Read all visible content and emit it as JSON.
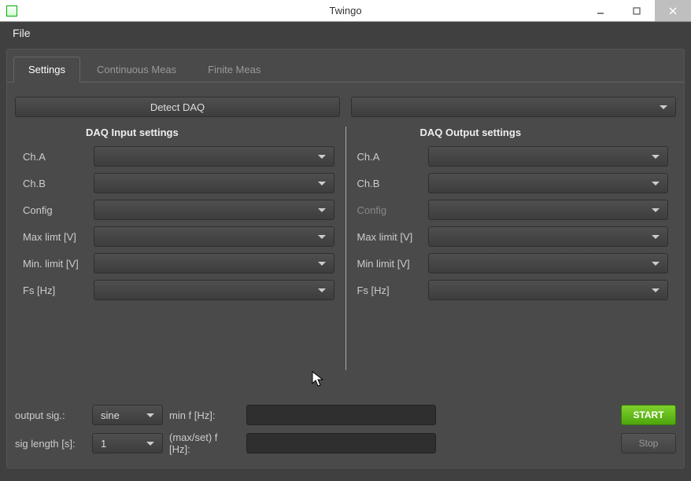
{
  "window": {
    "title": "Twingo"
  },
  "menu": {
    "file": "File"
  },
  "tabs": {
    "settings": "Settings",
    "continuous": "Continuous Meas",
    "finite": "Finite Meas"
  },
  "buttons": {
    "detect_daq": "Detect DAQ",
    "start": "START",
    "stop": "Stop"
  },
  "daq_select": {
    "value": ""
  },
  "input": {
    "title": "DAQ Input settings",
    "chA": {
      "label": "Ch.A",
      "value": ""
    },
    "chB": {
      "label": "Ch.B",
      "value": ""
    },
    "config": {
      "label": "Config",
      "value": ""
    },
    "maxlimit": {
      "label": "Max limt [V]",
      "value": ""
    },
    "minlimit": {
      "label": "Min. limit [V]",
      "value": ""
    },
    "fs": {
      "label": "Fs [Hz]",
      "value": ""
    }
  },
  "output": {
    "title": "DAQ Output settings",
    "chA": {
      "label": "Ch.A",
      "value": ""
    },
    "chB": {
      "label": "Ch.B",
      "value": ""
    },
    "config": {
      "label": "Config",
      "value": ""
    },
    "maxlimit": {
      "label": "Max limit [V]",
      "value": ""
    },
    "minlimit": {
      "label": "Min limit [V]",
      "value": ""
    },
    "fs": {
      "label": "Fs [Hz]",
      "value": ""
    }
  },
  "bottom": {
    "outsig": {
      "label": "output sig.:",
      "value": "sine"
    },
    "minf": {
      "label": "min f [Hz]:",
      "value": ""
    },
    "siglen": {
      "label": "sig length [s]:",
      "value": "1"
    },
    "maxsetf": {
      "label": "(max/set) f [Hz]:",
      "value": ""
    }
  }
}
